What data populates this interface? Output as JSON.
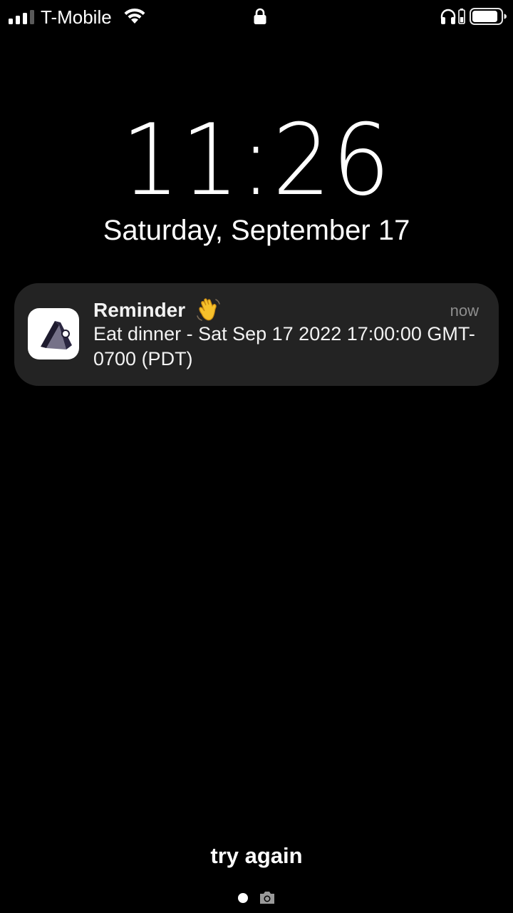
{
  "status_bar": {
    "carrier": "T-Mobile",
    "signal_bars": 3,
    "signal_icon": "cellular-signal-icon",
    "wifi_icon": "wifi-icon",
    "lock_icon": "lock-icon",
    "headphones_icon": "headphones-icon",
    "battery_icon": "battery-icon",
    "battery_level": 0.8
  },
  "lock_screen": {
    "time": "11:26",
    "date": "Saturday, September 17"
  },
  "notification": {
    "app_icon": "app-logo-icon",
    "title": "Reminder",
    "emoji": "waving-hand-emoji",
    "time": "now",
    "body": "Eat dinner - Sat Sep 17 2022 17:00:00 GMT-0700 (PDT)",
    "background_color": "#232323"
  },
  "bottom": {
    "hint": "try again",
    "camera_icon": "camera-icon"
  }
}
